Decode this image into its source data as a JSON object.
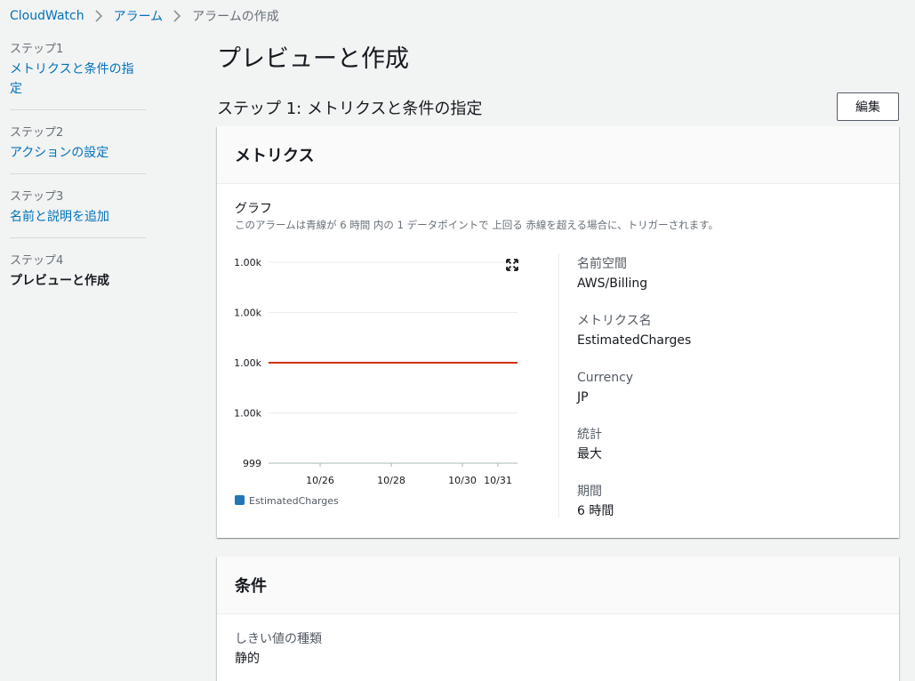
{
  "breadcrumb": {
    "items": [
      "CloudWatch",
      "アラーム"
    ],
    "current": "アラームの作成"
  },
  "nav": [
    {
      "num": "ステップ1",
      "label": "メトリクスと条件の指定"
    },
    {
      "num": "ステップ2",
      "label": "アクションの設定"
    },
    {
      "num": "ステップ3",
      "label": "名前と説明を追加"
    },
    {
      "num": "ステップ4",
      "label": "プレビューと作成"
    }
  ],
  "page": {
    "title": "プレビューと作成",
    "step_heading": "ステップ 1: メトリクスと条件の指定",
    "edit_label": "編集"
  },
  "metrics": {
    "header": "メトリクス",
    "graph_title": "グラフ",
    "graph_desc": "このアラームは青線が 6 時間 内の 1 データポイントで 上回る 赤線を超える場合に、トリガーされます。",
    "namespace_label": "名前空間",
    "namespace_value": "AWS/Billing",
    "metric_name_label": "メトリクス名",
    "metric_name_value": "EstimatedCharges",
    "currency_label": "Currency",
    "currency_value": "JP",
    "stat_label": "統計",
    "stat_value": "最大",
    "period_label": "期間",
    "period_value": "6 時間"
  },
  "conditions": {
    "header": "条件",
    "threshold_type_label": "しきい値の種類",
    "threshold_type_value": "静的"
  },
  "chart_data": {
    "type": "line",
    "y_tick_labels": [
      "1.00k",
      "1.00k",
      "1.00k",
      "1.00k",
      "999"
    ],
    "x": [
      "10/26",
      "10/28",
      "10/30",
      "10/31"
    ],
    "threshold_label": "1.00k",
    "series": [
      {
        "name": "EstimatedCharges",
        "values": []
      }
    ],
    "threshold_color": "#d13212",
    "series_color": "#1f77b4",
    "grid": true,
    "legend": "bottom-left"
  },
  "icons": {
    "breadcrumb_separator": "chevron-right-icon",
    "expand": "expand-icon"
  }
}
